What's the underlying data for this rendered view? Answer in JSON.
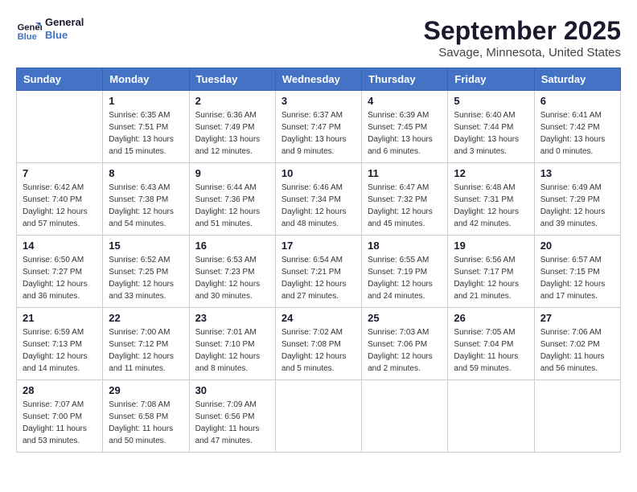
{
  "header": {
    "logo_line1": "General",
    "logo_line2": "Blue",
    "month": "September 2025",
    "location": "Savage, Minnesota, United States"
  },
  "days_of_week": [
    "Sunday",
    "Monday",
    "Tuesday",
    "Wednesday",
    "Thursday",
    "Friday",
    "Saturday"
  ],
  "weeks": [
    [
      {
        "day": "",
        "info": ""
      },
      {
        "day": "1",
        "info": "Sunrise: 6:35 AM\nSunset: 7:51 PM\nDaylight: 13 hours\nand 15 minutes."
      },
      {
        "day": "2",
        "info": "Sunrise: 6:36 AM\nSunset: 7:49 PM\nDaylight: 13 hours\nand 12 minutes."
      },
      {
        "day": "3",
        "info": "Sunrise: 6:37 AM\nSunset: 7:47 PM\nDaylight: 13 hours\nand 9 minutes."
      },
      {
        "day": "4",
        "info": "Sunrise: 6:39 AM\nSunset: 7:45 PM\nDaylight: 13 hours\nand 6 minutes."
      },
      {
        "day": "5",
        "info": "Sunrise: 6:40 AM\nSunset: 7:44 PM\nDaylight: 13 hours\nand 3 minutes."
      },
      {
        "day": "6",
        "info": "Sunrise: 6:41 AM\nSunset: 7:42 PM\nDaylight: 13 hours\nand 0 minutes."
      }
    ],
    [
      {
        "day": "7",
        "info": "Sunrise: 6:42 AM\nSunset: 7:40 PM\nDaylight: 12 hours\nand 57 minutes."
      },
      {
        "day": "8",
        "info": "Sunrise: 6:43 AM\nSunset: 7:38 PM\nDaylight: 12 hours\nand 54 minutes."
      },
      {
        "day": "9",
        "info": "Sunrise: 6:44 AM\nSunset: 7:36 PM\nDaylight: 12 hours\nand 51 minutes."
      },
      {
        "day": "10",
        "info": "Sunrise: 6:46 AM\nSunset: 7:34 PM\nDaylight: 12 hours\nand 48 minutes."
      },
      {
        "day": "11",
        "info": "Sunrise: 6:47 AM\nSunset: 7:32 PM\nDaylight: 12 hours\nand 45 minutes."
      },
      {
        "day": "12",
        "info": "Sunrise: 6:48 AM\nSunset: 7:31 PM\nDaylight: 12 hours\nand 42 minutes."
      },
      {
        "day": "13",
        "info": "Sunrise: 6:49 AM\nSunset: 7:29 PM\nDaylight: 12 hours\nand 39 minutes."
      }
    ],
    [
      {
        "day": "14",
        "info": "Sunrise: 6:50 AM\nSunset: 7:27 PM\nDaylight: 12 hours\nand 36 minutes."
      },
      {
        "day": "15",
        "info": "Sunrise: 6:52 AM\nSunset: 7:25 PM\nDaylight: 12 hours\nand 33 minutes."
      },
      {
        "day": "16",
        "info": "Sunrise: 6:53 AM\nSunset: 7:23 PM\nDaylight: 12 hours\nand 30 minutes."
      },
      {
        "day": "17",
        "info": "Sunrise: 6:54 AM\nSunset: 7:21 PM\nDaylight: 12 hours\nand 27 minutes."
      },
      {
        "day": "18",
        "info": "Sunrise: 6:55 AM\nSunset: 7:19 PM\nDaylight: 12 hours\nand 24 minutes."
      },
      {
        "day": "19",
        "info": "Sunrise: 6:56 AM\nSunset: 7:17 PM\nDaylight: 12 hours\nand 21 minutes."
      },
      {
        "day": "20",
        "info": "Sunrise: 6:57 AM\nSunset: 7:15 PM\nDaylight: 12 hours\nand 17 minutes."
      }
    ],
    [
      {
        "day": "21",
        "info": "Sunrise: 6:59 AM\nSunset: 7:13 PM\nDaylight: 12 hours\nand 14 minutes."
      },
      {
        "day": "22",
        "info": "Sunrise: 7:00 AM\nSunset: 7:12 PM\nDaylight: 12 hours\nand 11 minutes."
      },
      {
        "day": "23",
        "info": "Sunrise: 7:01 AM\nSunset: 7:10 PM\nDaylight: 12 hours\nand 8 minutes."
      },
      {
        "day": "24",
        "info": "Sunrise: 7:02 AM\nSunset: 7:08 PM\nDaylight: 12 hours\nand 5 minutes."
      },
      {
        "day": "25",
        "info": "Sunrise: 7:03 AM\nSunset: 7:06 PM\nDaylight: 12 hours\nand 2 minutes."
      },
      {
        "day": "26",
        "info": "Sunrise: 7:05 AM\nSunset: 7:04 PM\nDaylight: 11 hours\nand 59 minutes."
      },
      {
        "day": "27",
        "info": "Sunrise: 7:06 AM\nSunset: 7:02 PM\nDaylight: 11 hours\nand 56 minutes."
      }
    ],
    [
      {
        "day": "28",
        "info": "Sunrise: 7:07 AM\nSunset: 7:00 PM\nDaylight: 11 hours\nand 53 minutes."
      },
      {
        "day": "29",
        "info": "Sunrise: 7:08 AM\nSunset: 6:58 PM\nDaylight: 11 hours\nand 50 minutes."
      },
      {
        "day": "30",
        "info": "Sunrise: 7:09 AM\nSunset: 6:56 PM\nDaylight: 11 hours\nand 47 minutes."
      },
      {
        "day": "",
        "info": ""
      },
      {
        "day": "",
        "info": ""
      },
      {
        "day": "",
        "info": ""
      },
      {
        "day": "",
        "info": ""
      }
    ]
  ]
}
